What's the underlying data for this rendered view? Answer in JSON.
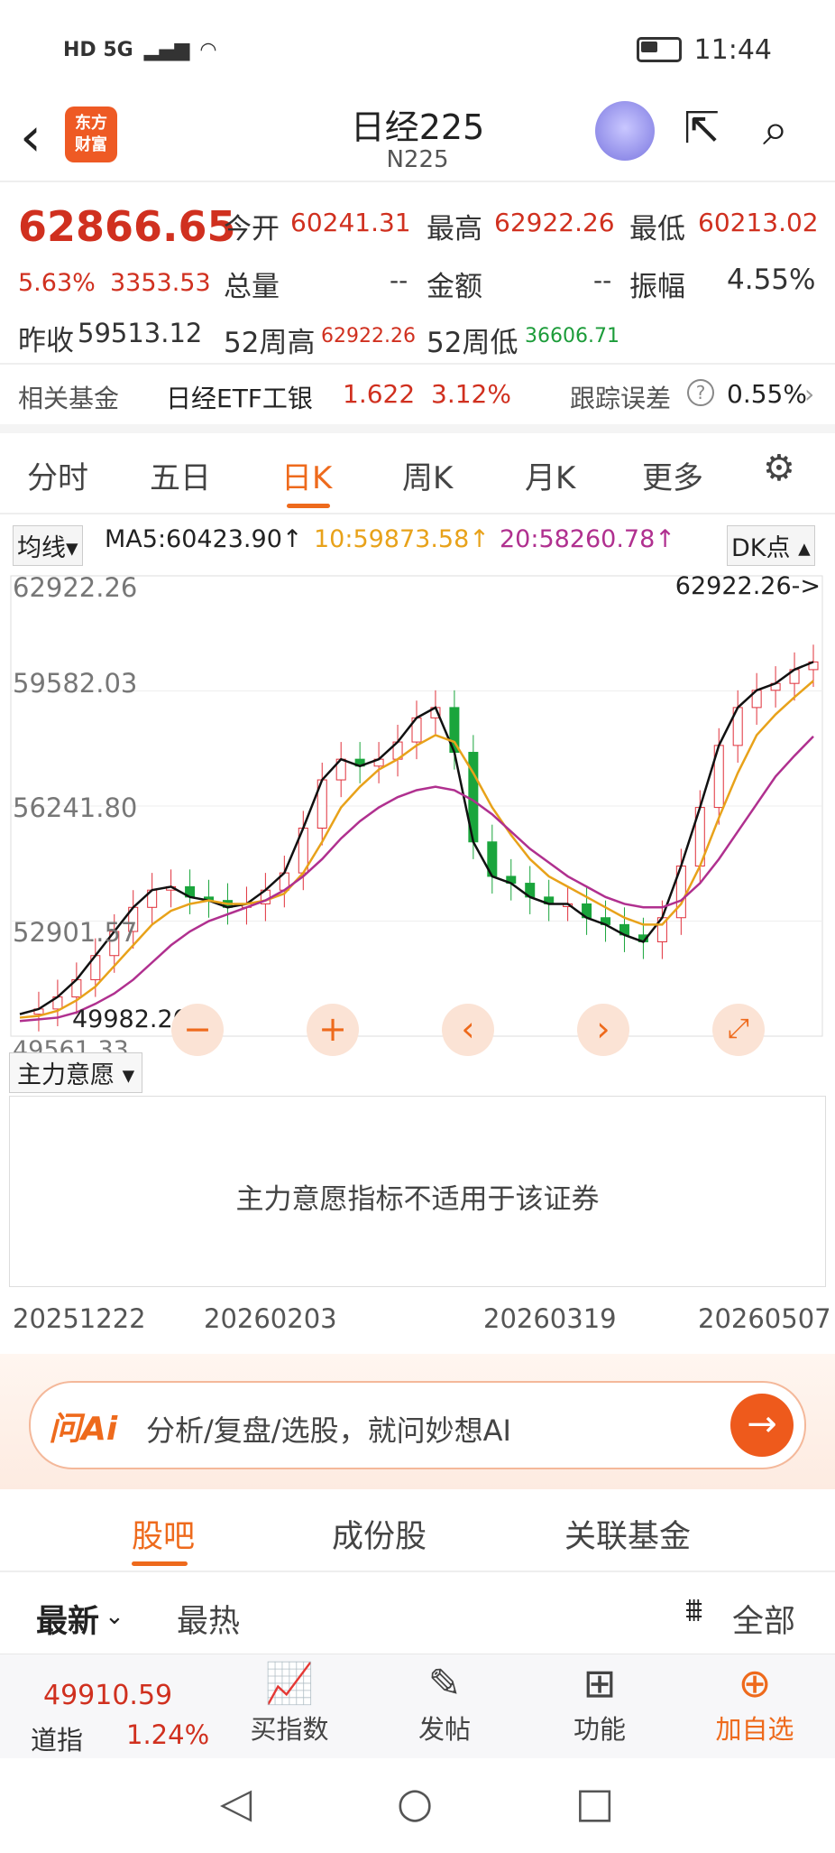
{
  "status": {
    "left": "HD 5G",
    "time": "11:44"
  },
  "nav": {
    "back": "‹",
    "logo_line1": "东方",
    "logo_line2": "财富",
    "title": "日经225",
    "subtitle": "N225"
  },
  "quote": {
    "price": "62866.65",
    "pct": "5.63%",
    "change": "3353.53",
    "prev_close_label": "昨收",
    "prev_close": "59513.12",
    "open_label": "今开",
    "open": "60241.31",
    "high_label": "最高",
    "high": "62922.26",
    "low_label": "最低",
    "low": "60213.02",
    "volume_label": "总量",
    "volume": "--",
    "amount_label": "金额",
    "amount": "--",
    "amplitude_label": "振幅",
    "amplitude": "4.55%",
    "w52high_label": "52周高",
    "w52high": "62922.26",
    "w52low_label": "52周低",
    "w52low": "36606.71"
  },
  "fund": {
    "label": "相关基金",
    "name": "日经ETF工银",
    "price": "1.622",
    "pct": "3.12%",
    "err_label": "跟踪误差",
    "err": "0.55%"
  },
  "tabs": [
    "分时",
    "五日",
    "日K",
    "周K",
    "月K",
    "更多"
  ],
  "ma": {
    "selector": "均线▾",
    "ma5": "MA5:60423.90↑",
    "ma10": "10:59873.58↑",
    "ma20": "20:58260.78↑",
    "dk": "DK点 ▴"
  },
  "chart": {
    "y_labels": [
      "62922.26",
      "59582.03",
      "56241.80",
      "52901.57",
      "49561.33"
    ],
    "max_label": "62922.26->",
    "min_label": "49982.20",
    "colors": {
      "up": "#e0303a",
      "down": "#1aa53c",
      "ma5": "#111111",
      "ma10": "#e8a21a",
      "ma20": "#b0308f"
    }
  },
  "chart_data": {
    "type": "candlestick",
    "ylim": [
      49561.33,
      62922.26
    ],
    "series": [
      {
        "name": "MA5",
        "values": [
          50200,
          50350,
          50700,
          51200,
          51900,
          52600,
          53300,
          53800,
          53900,
          53600,
          53500,
          53300,
          53400,
          53800,
          54300,
          55600,
          57000,
          57600,
          57400,
          57600,
          58100,
          58800,
          59100,
          57800,
          55200,
          54200,
          54000,
          53600,
          53400,
          53400,
          53000,
          52800,
          52500,
          52300,
          53000,
          54500,
          56200,
          58000,
          59100,
          59600,
          59800,
          60200,
          60423.9
        ]
      },
      {
        "name": "10",
        "values": [
          50100,
          50150,
          50300,
          50600,
          51000,
          51600,
          52200,
          52800,
          53200,
          53400,
          53500,
          53400,
          53400,
          53500,
          53700,
          54300,
          55200,
          56200,
          56800,
          57300,
          57600,
          58000,
          58300,
          58100,
          57200,
          56200,
          55400,
          54700,
          54200,
          53900,
          53600,
          53300,
          53000,
          52800,
          52800,
          53400,
          54500,
          55900,
          57200,
          58300,
          58900,
          59400,
          59873.58
        ]
      },
      {
        "name": "20",
        "values": [
          50000,
          50050,
          50100,
          50250,
          50500,
          50800,
          51200,
          51700,
          52200,
          52600,
          52900,
          53100,
          53300,
          53500,
          53800,
          54200,
          54700,
          55300,
          55800,
          56200,
          56500,
          56700,
          56800,
          56700,
          56400,
          56000,
          55500,
          55000,
          54600,
          54200,
          53900,
          53600,
          53400,
          53300,
          53300,
          53500,
          54000,
          54700,
          55500,
          56300,
          57100,
          57700,
          58260.78
        ]
      }
    ]
  },
  "indicator": {
    "selector": "主力意愿 ▾",
    "message": "主力意愿指标不适用于该证券"
  },
  "dates": [
    "20251222",
    "20260203",
    "20260319",
    "20260507"
  ],
  "ai": {
    "logo": "问Ai",
    "placeholder": "分析/复盘/选股，就问妙想AI"
  },
  "ctabs": [
    "股吧",
    "成份股",
    "关联基金"
  ],
  "sort": {
    "latest": "最新",
    "hot": "最热",
    "filter": "全部"
  },
  "bottom": {
    "index_price": "49910.59",
    "index_name": "道指",
    "index_pct": "1.24%",
    "items": [
      "买指数",
      "发帖",
      "功能",
      "加自选"
    ]
  }
}
